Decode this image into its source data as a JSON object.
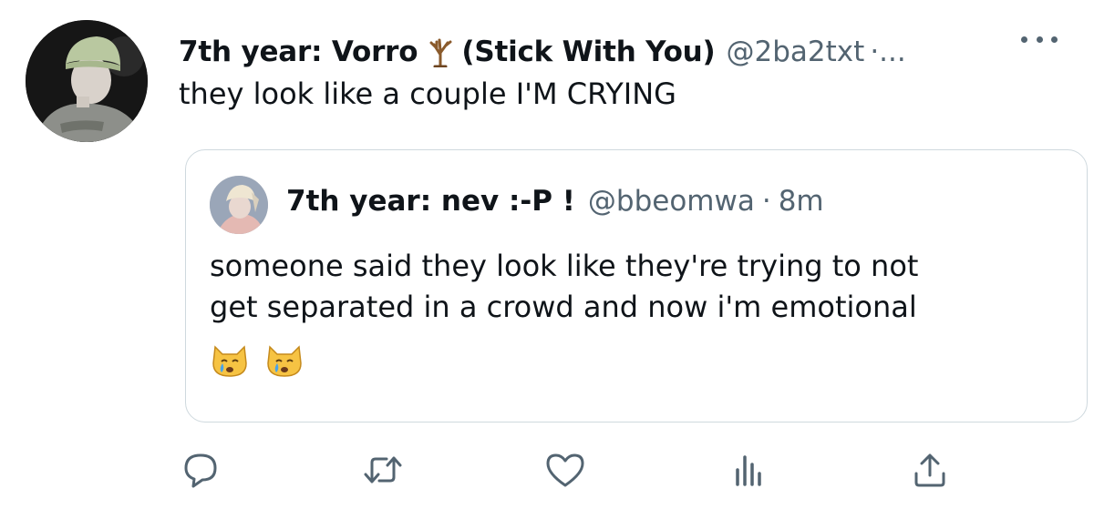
{
  "tweet": {
    "author": {
      "display_name": "7th year: Vorro",
      "name_icon": "bare-tree-emoji",
      "name_suffix": "(Stick With You)",
      "handle": "@2ba2txt",
      "separator": "·...",
      "avatar": "profile-photo"
    },
    "text": "they look like a couple I'M CRYING",
    "more_icon": "more-dots-icon"
  },
  "quote": {
    "author": {
      "display_name": "7th year: nev :-P !",
      "handle": "@bbeomwa",
      "dot": "·",
      "time": "8m",
      "avatar": "profile-photo"
    },
    "text_line1": "someone said they look like they're trying to not",
    "text_line2": "get separated in a crowd and now i'm emotional",
    "emoji": [
      "crying-cat-face",
      "crying-cat-face"
    ]
  },
  "actions": [
    {
      "name": "reply",
      "icon": "reply-icon"
    },
    {
      "name": "retweet",
      "icon": "retweet-icon"
    },
    {
      "name": "like",
      "icon": "heart-icon"
    },
    {
      "name": "analytics",
      "icon": "analytics-icon"
    },
    {
      "name": "share",
      "icon": "share-icon"
    }
  ],
  "colors": {
    "text": "#0f1419",
    "secondary": "#536471",
    "border": "#cfd9de",
    "icon": "#536471"
  }
}
